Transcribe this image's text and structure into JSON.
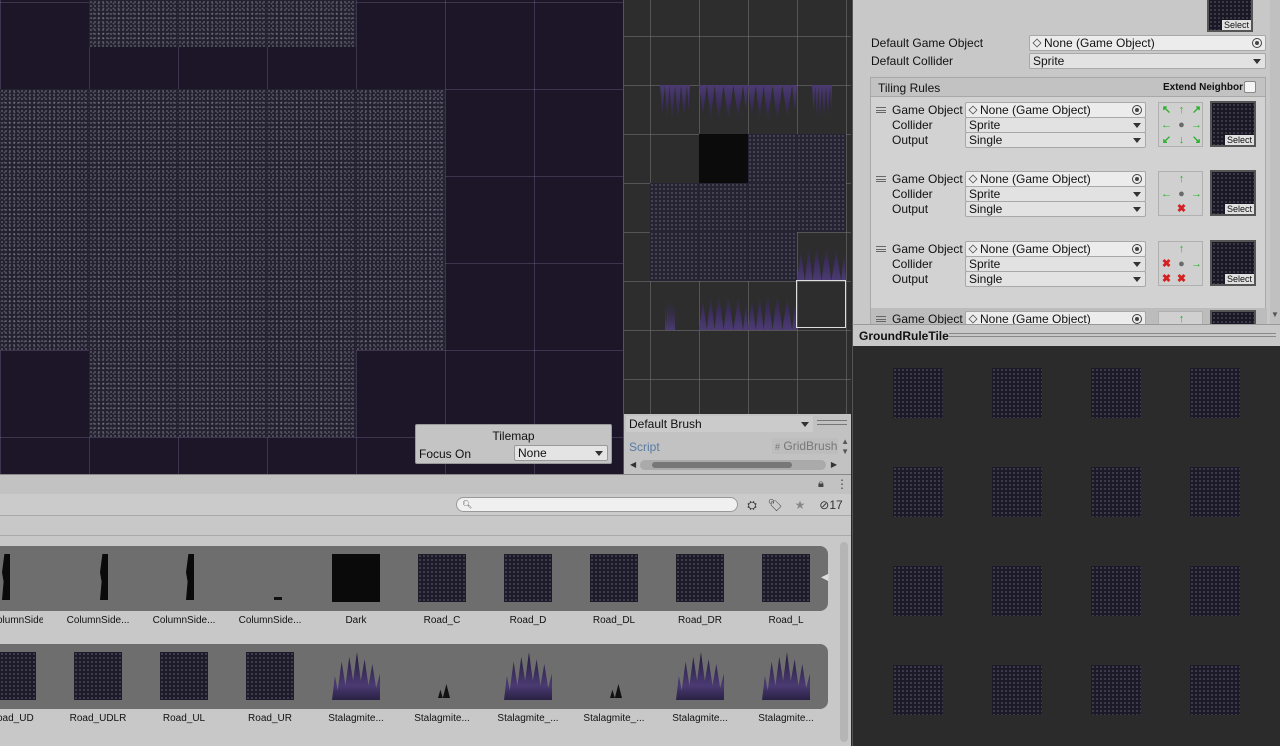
{
  "tilemap_overlay": {
    "title": "Tilemap",
    "focus_label": "Focus On",
    "focus_value": "None"
  },
  "brush": {
    "dropdown": "Default Brush",
    "script_label": "Script",
    "script_value": "GridBrush"
  },
  "inspector": {
    "top_preview_select": "Select",
    "default_game_object_label": "Default Game Object",
    "default_game_object_value": "None (Game Object)",
    "default_collider_label": "Default Collider",
    "default_collider_value": "Sprite",
    "tiling_rules_title": "Tiling Rules",
    "extend_neighbor_label": "Extend Neighbor",
    "rules": [
      {
        "go_label": "Game Object",
        "go_value": "None (Game Object)",
        "collider_label": "Collider",
        "collider_value": "Sprite",
        "output_label": "Output",
        "output_value": "Single",
        "select": "Select"
      },
      {
        "go_label": "Game Object",
        "go_value": "None (Game Object)",
        "collider_label": "Collider",
        "collider_value": "Sprite",
        "output_label": "Output",
        "output_value": "Single",
        "select": "Select"
      },
      {
        "go_label": "Game Object",
        "go_value": "None (Game Object)",
        "collider_label": "Collider",
        "collider_value": "Sprite",
        "output_label": "Output",
        "output_value": "Single",
        "select": "Select"
      },
      {
        "go_label": "Game Object",
        "go_value": "None (Game Object)"
      }
    ]
  },
  "preview_panel": {
    "title": "GroundRuleTile"
  },
  "project": {
    "hidden_count": "17",
    "row1": [
      "olumnSide...",
      "ColumnSide...",
      "ColumnSide...",
      "ColumnSide...",
      "Dark",
      "Road_C",
      "Road_D",
      "Road_DL",
      "Road_DR",
      "Road_L"
    ],
    "row2": [
      "oad_UD",
      "Road_UDLR",
      "Road_UL",
      "Road_UR",
      "Stalagmite...",
      "Stalagmite...",
      "Stalagmite_...",
      "Stalagmite_...",
      "Stalagmite...",
      "Stalagmite..."
    ]
  }
}
